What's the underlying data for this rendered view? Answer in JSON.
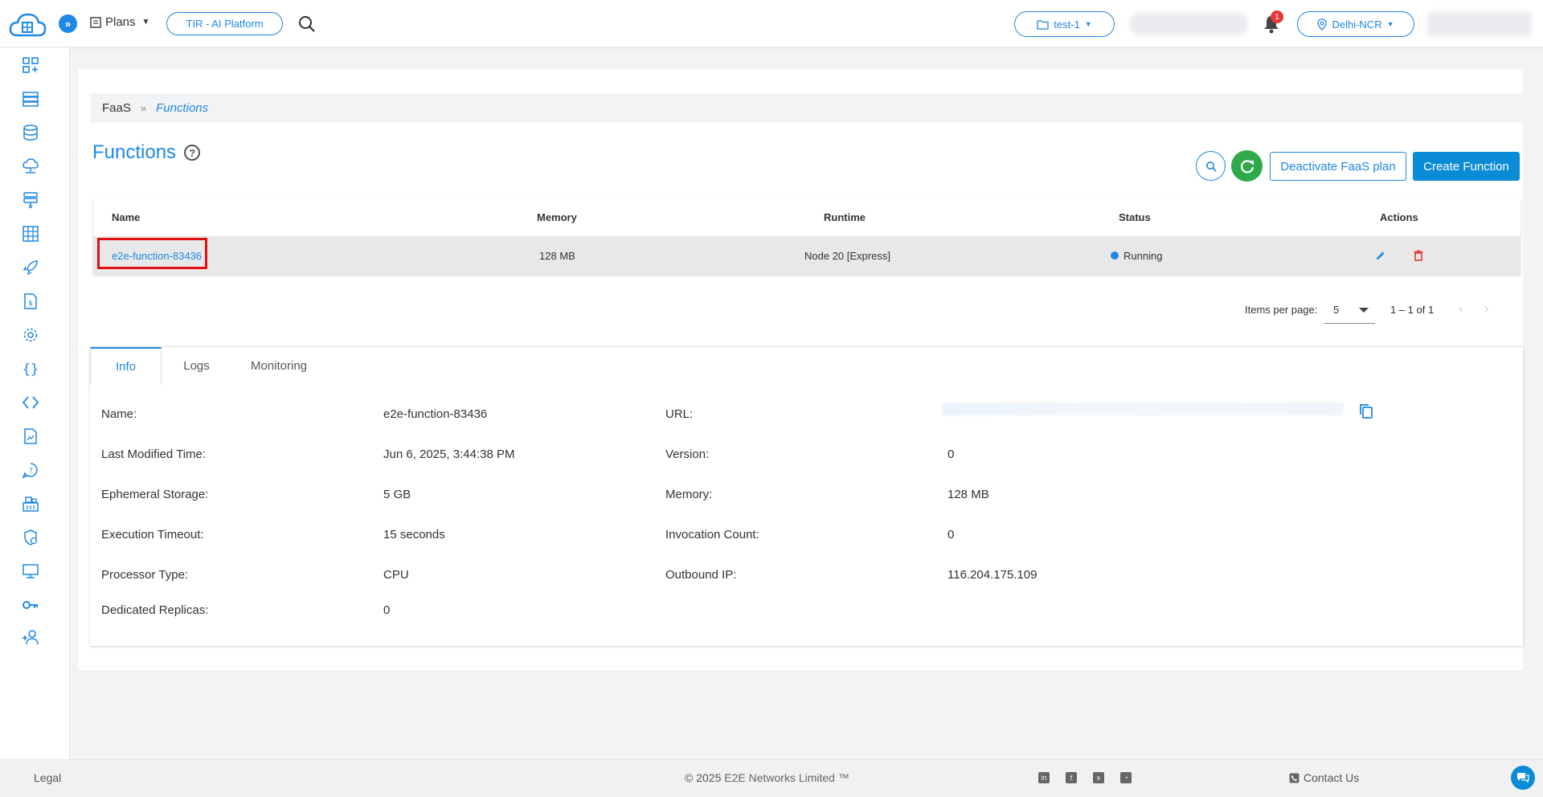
{
  "topbar": {
    "plans_label": "Plans",
    "platform_button": "TIR - AI Platform",
    "project_label": "test-1",
    "notification_count": "1",
    "region_label": "Delhi-NCR",
    "icons": [
      "cloud-logo-icon",
      "chevrons-right-icon",
      "plans-icon",
      "search-icon",
      "folder-icon",
      "bell-icon",
      "location-pin-icon"
    ]
  },
  "sidebar": {
    "items": [
      "dashboard-icon",
      "nodes-icon",
      "database-icon",
      "cdn-icon",
      "load-balancer-icon",
      "grid-icon",
      "rocket-icon",
      "billing-icon",
      "settings-icon",
      "functions-icon",
      "code-icon",
      "document-icon",
      "support-icon",
      "container-registry-icon",
      "security-icon",
      "monitor-icon",
      "key-icon",
      "add-user-icon"
    ]
  },
  "breadcrumb": {
    "root": "FaaS",
    "separator": "»",
    "current": "Functions"
  },
  "page": {
    "title": "Functions",
    "help": "?",
    "deactivate_button": "Deactivate FaaS plan",
    "create_button": "Create Function"
  },
  "table": {
    "columns": [
      "Name",
      "Memory",
      "Runtime",
      "Status",
      "Actions"
    ],
    "rows": [
      {
        "name": "e2e-function-83436",
        "memory": "128 MB",
        "runtime": "Node 20 [Express]",
        "status": "Running"
      }
    ]
  },
  "pagination": {
    "items_per_page_label": "Items per page:",
    "items_per_page_value": "5",
    "range": "1 – 1 of 1"
  },
  "tabs": [
    "Info",
    "Logs",
    "Monitoring"
  ],
  "info": {
    "left": [
      {
        "label": "Name:",
        "value": "e2e-function-83436"
      },
      {
        "label": "Last Modified Time:",
        "value": "Jun 6, 2025, 3:44:38 PM"
      },
      {
        "label": "Ephemeral Storage:",
        "value": "5 GB"
      },
      {
        "label": "Execution Timeout:",
        "value": "15 seconds"
      },
      {
        "label": "Processor Type:",
        "value": "CPU"
      },
      {
        "label": "Dedicated Replicas:",
        "value": "0"
      }
    ],
    "right": [
      {
        "label": "URL:",
        "value": ""
      },
      {
        "label": "Version:",
        "value": "0"
      },
      {
        "label": "Memory:",
        "value": "128 MB"
      },
      {
        "label": "Invocation Count:",
        "value": "0"
      },
      {
        "label": "Outbound IP:",
        "value": "116.204.175.109"
      }
    ]
  },
  "footer": {
    "legal": "Legal",
    "copyright_prefix": "© 2025",
    "copyright_brand": "E2E Networks Limited ™",
    "contact": "Contact Us",
    "social_icons": [
      "linkedin-icon",
      "facebook-icon",
      "x-icon",
      "rss-icon"
    ]
  },
  "colors": {
    "accent": "#1e88e5",
    "primary_button": "#0a8bd6",
    "refresh_green": "#2eaa4a",
    "delete_red": "#e53935",
    "highlight_red": "#e01010"
  }
}
